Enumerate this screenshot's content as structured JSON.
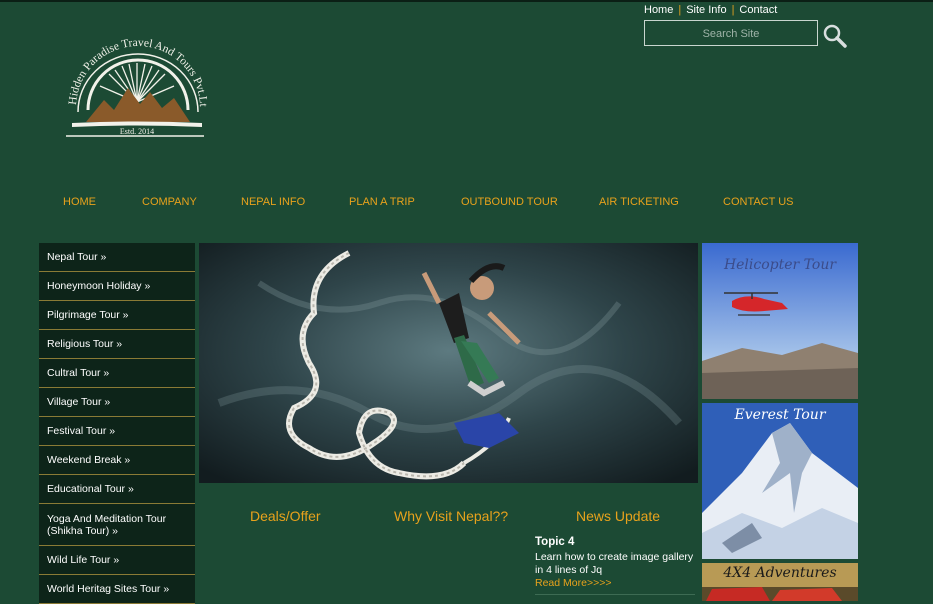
{
  "top_links": [
    "Home",
    "Site Info",
    "Contact"
  ],
  "search": {
    "placeholder": "Search Site"
  },
  "logo": {
    "name": "Hidden Paradise Travel And Tours Pvt.Ltd",
    "established": "Estd. 2014"
  },
  "nav": [
    "HOME",
    "COMPANY",
    "NEPAL INFO",
    "PLAN A TRIP",
    "OUTBOUND TOUR",
    "AIR TICKETING",
    "CONTACT US"
  ],
  "sidebar": [
    "Nepal Tour »",
    "Honeymoon Holiday »",
    "Pilgrimage Tour »",
    "Religious Tour »",
    "Cultral Tour »",
    "Village Tour »",
    "Festival Tour »",
    "Weekend Break »",
    "Educational Tour »",
    "Yoga And Meditation Tour (Shikha Tour) »",
    "Wild Life Tour »",
    "World Heritag Sites Tour »"
  ],
  "columns": [
    "Deals/Offer",
    "Why Visit Nepal??",
    "News Update"
  ],
  "news": {
    "topic": "Topic 4",
    "text": "Learn how to create image gallery in 4 lines of Jq",
    "more": "Read More>>>>"
  },
  "tiles": [
    "Helicopter Tour",
    "Everest Tour",
    "4X4 Adventures"
  ],
  "colors": {
    "background": "#1c4a34",
    "accent": "#e8a21c",
    "sidebar_bg": "#0d2419"
  }
}
